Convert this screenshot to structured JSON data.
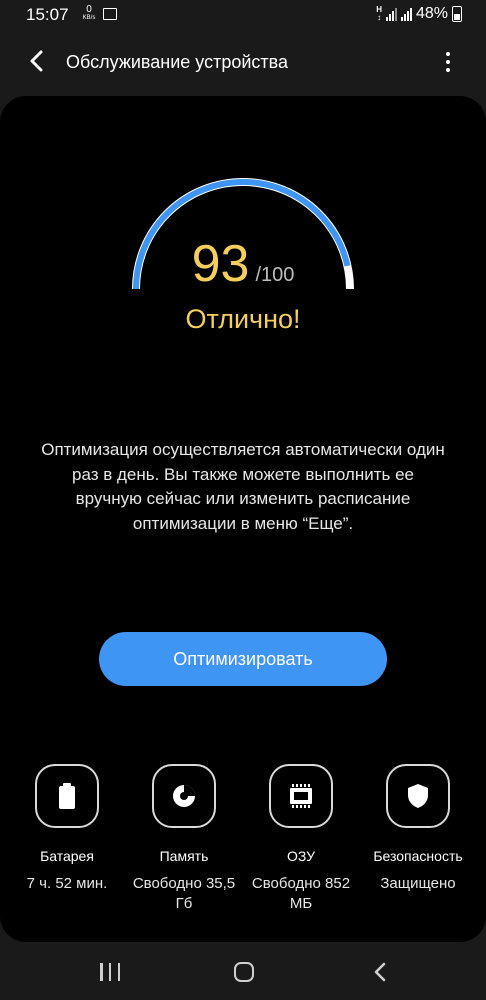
{
  "status_bar": {
    "time": "15:07",
    "net_speed_value": "0",
    "net_speed_unit": "KB/s",
    "battery_percent": "48%"
  },
  "header": {
    "title": "Обслуживание устройства"
  },
  "score": {
    "value": "93",
    "max": "/100",
    "fraction": 0.93,
    "status": "Отлично!"
  },
  "description": "Оптимизация осуществляется автоматически один раз в день. Вы также можете выполнить ее вручную сейчас или изменить расписание оптимизации в меню “Еще”.",
  "optimize_button": "Оптимизировать",
  "tiles": [
    {
      "icon": "battery-icon",
      "label": "Батарея",
      "value": "7 ч. 52 мин."
    },
    {
      "icon": "storage-pie-icon",
      "label": "Память",
      "value": "Свободно 35,5 Гб"
    },
    {
      "icon": "memory-chip-icon",
      "label": "ОЗУ",
      "value": "Свободно 852 МБ"
    },
    {
      "icon": "shield-icon",
      "label": "Безопасность",
      "value": "Защищено"
    }
  ],
  "colors": {
    "accent": "#3e95f3",
    "score": "#f5cf5a",
    "background": "#1a1a1a",
    "card": "#000000"
  }
}
